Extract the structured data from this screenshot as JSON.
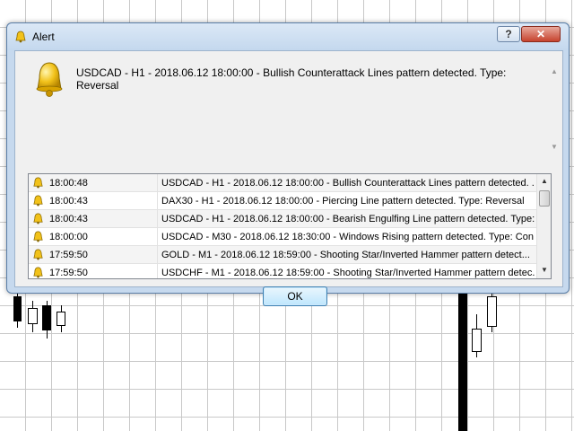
{
  "window": {
    "title": "Alert",
    "help_label": "?",
    "close_label": "✕"
  },
  "message": "USDCAD - H1 - 2018.06.12 18:00:00 - Bullish Counterattack Lines pattern detected. Type: Reversal",
  "alerts": [
    {
      "time": "18:00:48",
      "text": "USDCAD - H1 - 2018.06.12 18:00:00 - Bullish Counterattack Lines pattern detected. ..."
    },
    {
      "time": "18:00:43",
      "text": "DAX30 - H1 - 2018.06.12 18:00:00 - Piercing Line pattern detected. Type: Reversal"
    },
    {
      "time": "18:00:43",
      "text": "USDCAD - H1 - 2018.06.12 18:00:00 - Bearish Engulfing Line pattern detected. Type:..."
    },
    {
      "time": "18:00:00",
      "text": "USDCAD - M30 - 2018.06.12 18:30:00 - Windows Rising pattern detected. Type: Con..."
    },
    {
      "time": "17:59:50",
      "text": "GOLD - M1 - 2018.06.12 18:59:00 - Shooting Star/Inverted Hammer pattern detect..."
    },
    {
      "time": "17:59:50",
      "text": "USDCHF - M1 - 2018.06.12 18:59:00 - Shooting Star/Inverted Hammer pattern detec..."
    }
  ],
  "ok_label": "OK",
  "icons": {
    "title": "bell-icon",
    "message": "bell-icon",
    "row": "bell-icon"
  },
  "colors": {
    "bell": "#f2c21a",
    "dialog_frame": "#c6d9ee",
    "ok_border": "#3c7fb1",
    "close_button": "#c7432e"
  }
}
